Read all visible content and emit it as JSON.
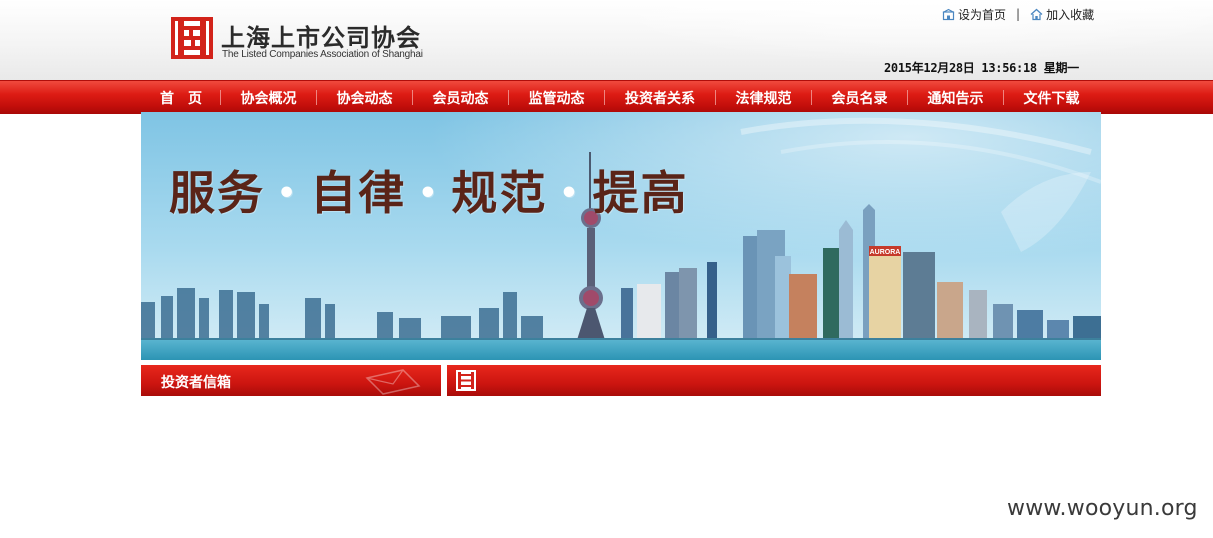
{
  "header": {
    "logo_cn": "上海上市公司协会",
    "logo_en": "The Listed Companies Association of Shanghai",
    "logo_icon": "association-logo-icon",
    "top_links": {
      "set_home": "设为首页",
      "set_home_icon": "home-icon",
      "separator": "|",
      "add_favorite": "加入收藏",
      "add_favorite_icon": "house-icon"
    },
    "datetime": "2015年12月28日 13:56:18 星期一"
  },
  "nav": {
    "items": [
      {
        "label": "首　页"
      },
      {
        "label": "协会概况"
      },
      {
        "label": "协会动态"
      },
      {
        "label": "会员动态"
      },
      {
        "label": "监管动态"
      },
      {
        "label": "投资者关系"
      },
      {
        "label": "法律规范"
      },
      {
        "label": "会员名录"
      },
      {
        "label": "通知告示"
      },
      {
        "label": "文件下载"
      }
    ]
  },
  "banner": {
    "slogan": [
      "服务",
      "自律",
      "规范",
      "提高"
    ],
    "slogan_dot": "•",
    "building_sign": "AURORA"
  },
  "sections": {
    "mailbox_label": "投资者信箱"
  },
  "watermark": "www.wooyun.org",
  "colors": {
    "nav_red": "#d81a12",
    "slogan_brown": "#5a2418",
    "logo_red": "#d2231a",
    "sky_blue": "#8ccbe6",
    "water_teal": "#3fa8c4"
  }
}
